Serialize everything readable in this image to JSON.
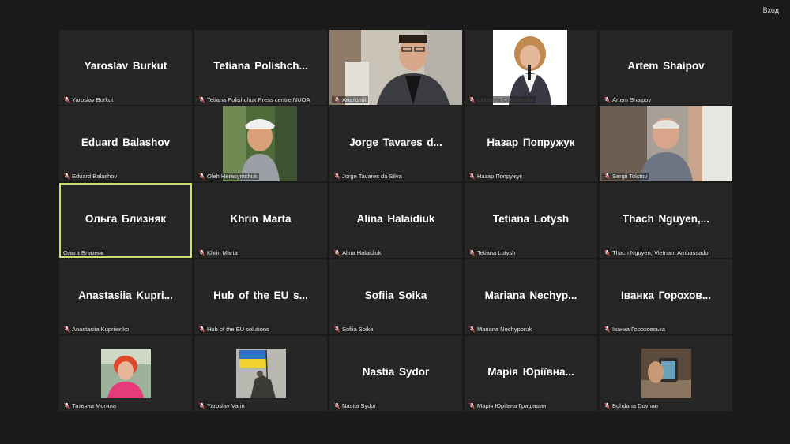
{
  "window": {
    "enter_button": "Вход"
  },
  "colors": {
    "background": "#1a1a1a",
    "tile": "#262626",
    "active_border": "#c6e06a",
    "muted_icon": "#e8453c"
  },
  "participants": [
    {
      "display": "Yaroslav Burkut",
      "label": "Yaroslav Burkut"
    },
    {
      "display": "Tetiana  Polishch...",
      "label": "Tetiana Polishchuk Press centre NUOA"
    },
    {
      "display": "",
      "label": "Анатолій"
    },
    {
      "display": "",
      "label": "Liudmyla Chekalenko"
    },
    {
      "display": "Artem Shaipov",
      "label": "Artem Shaipov"
    },
    {
      "display": "Eduard Balashov",
      "label": "Eduard Balashov"
    },
    {
      "display": "",
      "label": "Oleh Herasymchuk"
    },
    {
      "display": "Jorge  Tavares  d...",
      "label": "Jorge Tavares da Silva"
    },
    {
      "display": "Назар Попружук",
      "label": "Назар Попружук"
    },
    {
      "display": "",
      "label": "Sergii Tolstov"
    },
    {
      "display": "Ольга Близняк",
      "label": "Ольга Близняк"
    },
    {
      "display": "Khrin Marta",
      "label": "Khrin Marta"
    },
    {
      "display": "Alina Halaidiuk",
      "label": "Alina Halaidiuk"
    },
    {
      "display": "Tetiana Lotysh",
      "label": "Tetiana Lotysh"
    },
    {
      "display": "Thach  Nguyen,...",
      "label": "Thach Nguyen, Vietnam Ambassador"
    },
    {
      "display": "Anastasiia  Kupri...",
      "label": "Anastasiia Kupriienko"
    },
    {
      "display": "Hub  of the EU s...",
      "label": "Hub of the EU solutions"
    },
    {
      "display": "Sofiia Soika",
      "label": "Sofiia Soika"
    },
    {
      "display": "Mariana  Nechyp...",
      "label": "Mariana Nechyporuk"
    },
    {
      "display": "Іванка  Горохов...",
      "label": "Іванка Гороховська"
    },
    {
      "display": "",
      "label": "Татьяна Могила"
    },
    {
      "display": "",
      "label": "Yaroslav Varin"
    },
    {
      "display": "Nastia Sydor",
      "label": "Nastia Sydor"
    },
    {
      "display": "Марія  Юріївна...",
      "label": "Марія Юріївна Грицишин"
    },
    {
      "display": "",
      "label": "Bohdana Dovhan"
    }
  ]
}
